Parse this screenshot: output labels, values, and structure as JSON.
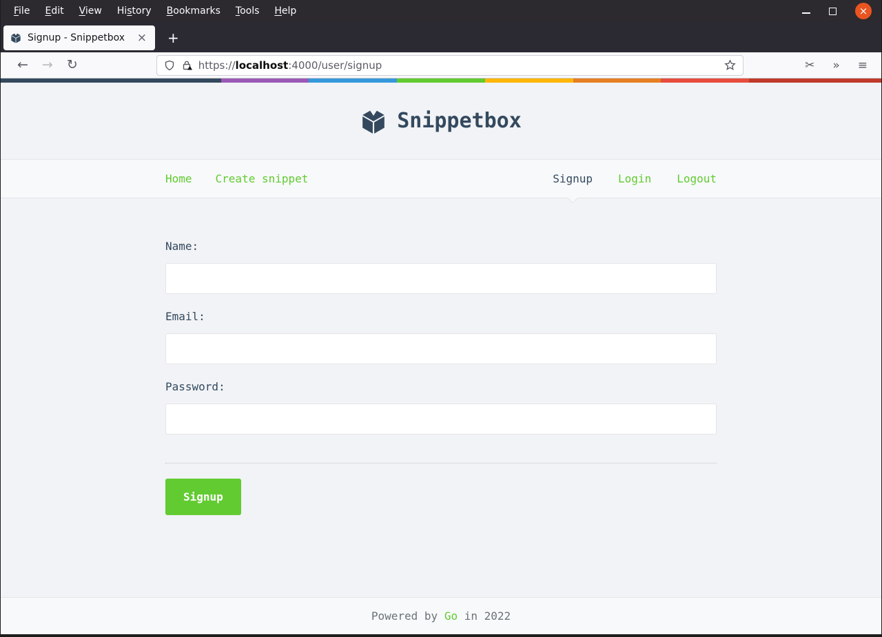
{
  "browser": {
    "menubar": {
      "items": [
        {
          "pre": "",
          "accel": "F",
          "post": "ile"
        },
        {
          "pre": "",
          "accel": "E",
          "post": "dit"
        },
        {
          "pre": "",
          "accel": "V",
          "post": "iew"
        },
        {
          "pre": "Hi",
          "accel": "s",
          "post": "tory"
        },
        {
          "pre": "",
          "accel": "B",
          "post": "ookmarks"
        },
        {
          "pre": "",
          "accel": "T",
          "post": "ools"
        },
        {
          "pre": "",
          "accel": "H",
          "post": "elp"
        }
      ]
    },
    "tab": {
      "title": "Signup - Snippetbox"
    },
    "url": {
      "scheme": "https://",
      "host": "localhost",
      "rest": ":4000/user/signup"
    }
  },
  "icons": {
    "back": "←",
    "forward": "→",
    "reload": "↻",
    "screenshot": "✂",
    "overflow": "»",
    "app_menu": "≡",
    "new_tab": "+",
    "close_x": "×",
    "window_close": "×"
  },
  "page": {
    "brand": "Snippetbox",
    "nav": {
      "left": [
        {
          "label": "Home"
        },
        {
          "label": "Create snippet"
        }
      ],
      "right": [
        {
          "label": "Signup",
          "active": true
        },
        {
          "label": "Login"
        },
        {
          "label": "Logout"
        }
      ]
    },
    "form": {
      "fields": [
        {
          "label": "Name:"
        },
        {
          "label": "Email:"
        },
        {
          "label": "Password:"
        }
      ],
      "submit_label": "Signup"
    },
    "footer": {
      "prefix": "Powered by ",
      "link": "Go",
      "suffix": " in 2022"
    },
    "rainbow": [
      {
        "color": "#34495e",
        "pct": 25
      },
      {
        "color": "#9b59b6",
        "pct": 10
      },
      {
        "color": "#3498db",
        "pct": 10
      },
      {
        "color": "#62cb31",
        "pct": 10
      },
      {
        "color": "#ffb606",
        "pct": 10
      },
      {
        "color": "#e67e22",
        "pct": 10
      },
      {
        "color": "#e74c3c",
        "pct": 10
      },
      {
        "color": "#c0392b",
        "pct": 15
      }
    ],
    "colors": {
      "accent_green": "#62CB31",
      "brand_slate": "#34495E",
      "body_bg": "#F1F3F6",
      "panel_bg": "#F7F9FA",
      "border": "#E4E5E7",
      "close_button": "#E95420"
    }
  }
}
